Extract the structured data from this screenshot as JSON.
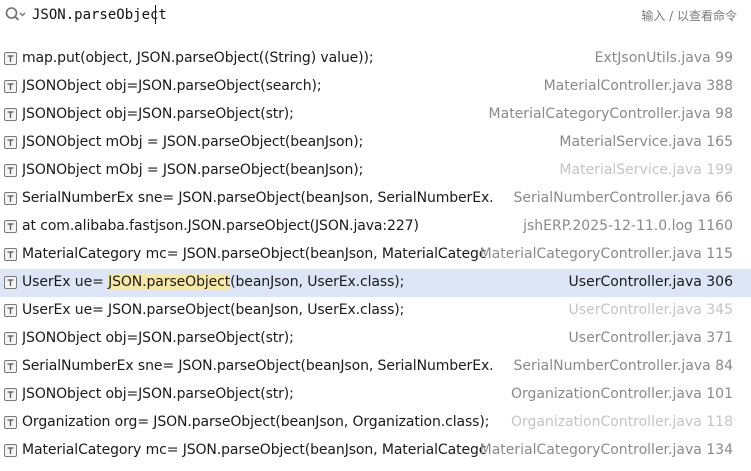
{
  "search": {
    "query": "JSON.parseObject",
    "hint": "输入 / 以查看命令"
  },
  "results": [
    {
      "pre": "map.put(object, JSON.parseObject((String) value));",
      "hl": "",
      "post": "",
      "location": "ExtJsonUtils.java 99",
      "faded": false
    },
    {
      "pre": "JSONObject obj=JSON.parseObject(search);",
      "hl": "",
      "post": "",
      "location": "MaterialController.java 388",
      "faded": false
    },
    {
      "pre": "JSONObject obj=JSON.parseObject(str);",
      "hl": "",
      "post": "",
      "location": "MaterialCategoryController.java 98",
      "faded": false
    },
    {
      "pre": "JSONObject mObj = JSON.parseObject(beanJson);",
      "hl": "",
      "post": "",
      "location": "MaterialService.java 165",
      "faded": false
    },
    {
      "pre": "JSONObject mObj = JSON.parseObject(beanJson);",
      "hl": "",
      "post": "",
      "location": "MaterialService.java 199",
      "faded": true
    },
    {
      "pre": "SerialNumberEx sne= JSON.parseObject(beanJson, SerialNumberEx.class",
      "hl": "",
      "post": "",
      "location": "SerialNumberController.java 66",
      "faded": false
    },
    {
      "pre": "at com.alibaba.fastjson.JSON.parseObject(JSON.java:227)",
      "hl": "",
      "post": "",
      "location": "jshERP.2025-12-11.0.log 1160",
      "faded": false
    },
    {
      "pre": "MaterialCategory mc= JSON.parseObject(beanJson, MaterialCategc",
      "hl": "",
      "post": "",
      "location": "MaterialCategoryController.java 115",
      "faded": false
    },
    {
      "pre": "UserEx ue= ",
      "hl": "JSON.parseObject",
      "post": "(beanJson, UserEx.class);",
      "location": "UserController.java 306",
      "faded": false,
      "selected": true
    },
    {
      "pre": "UserEx ue= JSON.parseObject(beanJson, UserEx.class);",
      "hl": "",
      "post": "",
      "location": "UserController.java 345",
      "faded": true
    },
    {
      "pre": "JSONObject obj=JSON.parseObject(str);",
      "hl": "",
      "post": "",
      "location": "UserController.java 371",
      "faded": false
    },
    {
      "pre": "SerialNumberEx sne= JSON.parseObject(beanJson, SerialNumberEx.class",
      "hl": "",
      "post": "",
      "location": "SerialNumberController.java 84",
      "faded": false
    },
    {
      "pre": "JSONObject obj=JSON.parseObject(str);",
      "hl": "",
      "post": "",
      "location": "OrganizationController.java 101",
      "faded": false
    },
    {
      "pre": "Organization org= JSON.parseObject(beanJson, Organization.class);",
      "hl": "",
      "post": "",
      "location": "OrganizationController.java 118",
      "faded": true
    },
    {
      "pre": "MaterialCategory mc= JSON.parseObject(beanJson, MaterialCategc",
      "hl": "",
      "post": "",
      "location": "MaterialCategoryController.java 134",
      "faded": false
    }
  ],
  "icons": {
    "search": "search-icon",
    "result_type": "text-file-icon"
  },
  "colors": {
    "selected_row": "#dde6f6",
    "match_highlight": "#f8e8a8",
    "location_text": "#8a8a8a"
  }
}
